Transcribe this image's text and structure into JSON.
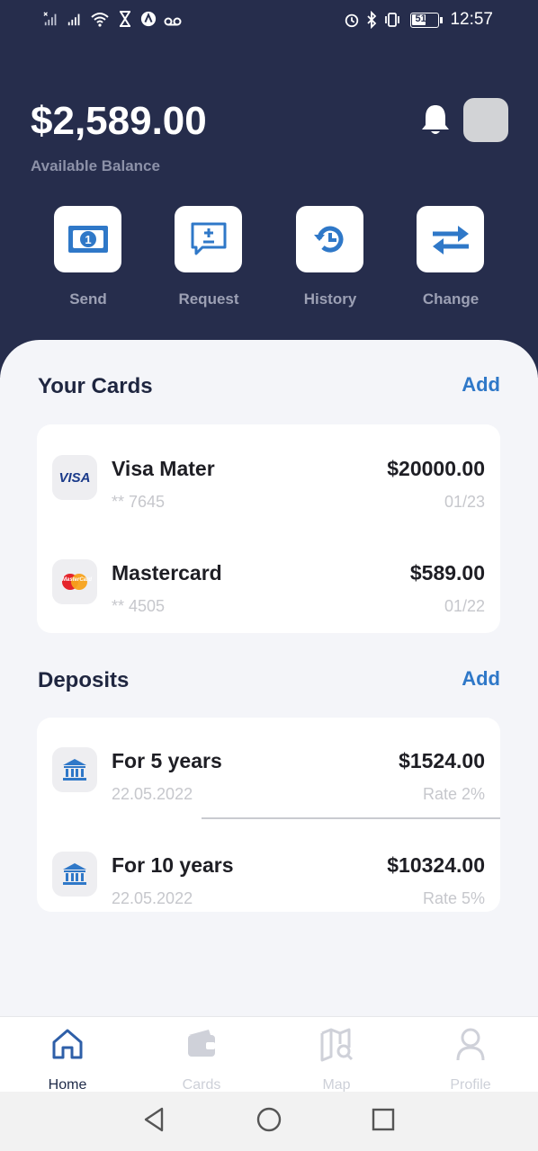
{
  "status": {
    "battery": "51",
    "time": "12:57"
  },
  "balance": {
    "amount": "$2,589.00",
    "label": "Available Balance"
  },
  "actions": [
    {
      "label": "Send"
    },
    {
      "label": "Request"
    },
    {
      "label": "History"
    },
    {
      "label": "Change"
    }
  ],
  "cards_section": {
    "title": "Your Cards",
    "add": "Add",
    "items": [
      {
        "name": "Visa Mater",
        "number": "** 7645",
        "amount": "$20000.00",
        "expiry": "01/23",
        "icon_text": "VISA"
      },
      {
        "name": "Mastercard",
        "number": "** 4505",
        "amount": "$589.00",
        "expiry": "01/22",
        "icon_text": "MasterCard"
      }
    ]
  },
  "deposits_section": {
    "title": "Deposits",
    "add": "Add",
    "items": [
      {
        "name": "For 5 years",
        "date": "22.05.2022",
        "amount": "$1524.00",
        "rate": "Rate 2%"
      },
      {
        "name": "For 10 years",
        "date": "22.05.2022",
        "amount": "$10324.00",
        "rate": "Rate 5%"
      }
    ]
  },
  "nav": [
    {
      "label": "Home",
      "icon": "home-icon",
      "active": true
    },
    {
      "label": "Cards",
      "icon": "wallet-icon",
      "active": false
    },
    {
      "label": "Map",
      "icon": "map-search-icon",
      "active": false
    },
    {
      "label": "Profile",
      "icon": "user-icon",
      "active": false
    }
  ],
  "colors": {
    "header": "#262d4c",
    "accent": "#2f78c8",
    "background": "#f4f5f9"
  }
}
